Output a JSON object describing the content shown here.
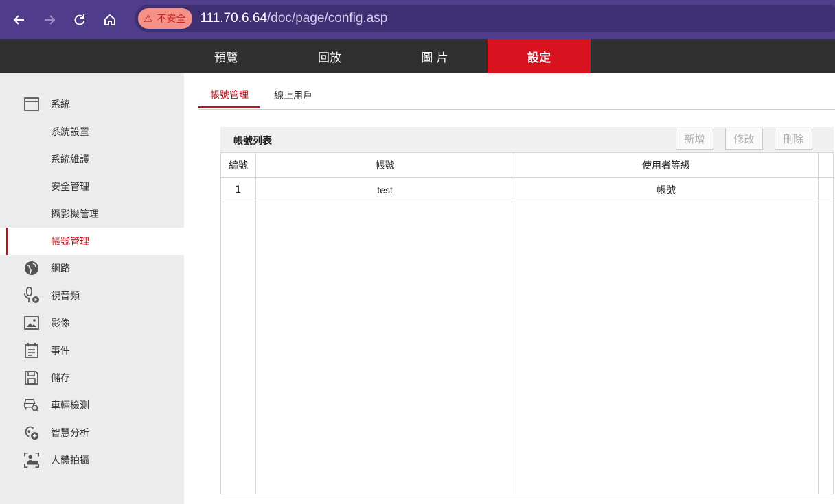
{
  "browser": {
    "security_label": "不安全",
    "url_host": "111.70.6.64",
    "url_path": "/doc/page/config.asp"
  },
  "topnav": {
    "tabs": [
      {
        "label": "預覽"
      },
      {
        "label": "回放"
      },
      {
        "label": "圖 片"
      },
      {
        "label": "設定"
      }
    ],
    "active": "設定"
  },
  "sidebar": {
    "items": [
      {
        "label": "系統",
        "icon": "window-icon"
      },
      {
        "label": "系統設置"
      },
      {
        "label": "系統維護"
      },
      {
        "label": "安全管理"
      },
      {
        "label": "攝影機管理"
      },
      {
        "label": "帳號管理"
      },
      {
        "label": "網路",
        "icon": "globe-icon"
      },
      {
        "label": "視音頻",
        "icon": "microphone-icon"
      },
      {
        "label": "影像",
        "icon": "image-icon"
      },
      {
        "label": "事件",
        "icon": "calendar-icon"
      },
      {
        "label": "儲存",
        "icon": "floppy-disk-icon"
      },
      {
        "label": "車輛檢測",
        "icon": "vehicle-detect-icon"
      },
      {
        "label": "智慧分析",
        "icon": "smart-analysis-icon"
      },
      {
        "label": "人體拍攝",
        "icon": "person-capture-icon"
      }
    ],
    "active": "帳號管理"
  },
  "subtabs": [
    {
      "label": "帳號管理"
    },
    {
      "label": "線上用戶"
    }
  ],
  "panel": {
    "title": "帳號列表",
    "buttons": {
      "add": "新增",
      "edit": "修改",
      "delete": "刪除"
    }
  },
  "table": {
    "headers": [
      "編號",
      "帳號",
      "使用者等級"
    ],
    "rows": [
      [
        "1",
        "test",
        "帳號"
      ]
    ]
  },
  "colors": {
    "browser_bar": "#4f3c8a",
    "topnav_bg": "#2f2f2f",
    "accent_red": "#d9121f",
    "sidebar_bg": "#ececec"
  }
}
